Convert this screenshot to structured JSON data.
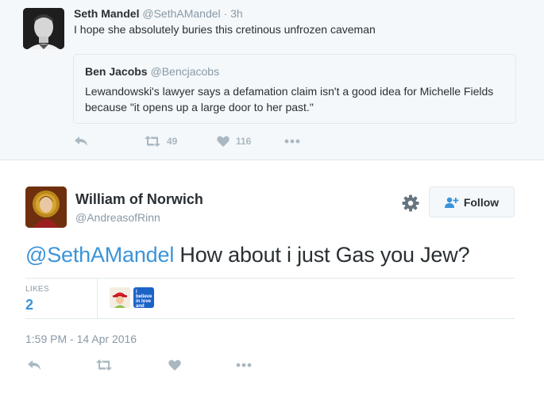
{
  "context_tweet": {
    "name": "Seth Mandel",
    "handle": "@SethAMandel",
    "separator": "·",
    "time": "3h",
    "text": "I hope she absolutely buries this cretinous unfrozen caveman",
    "quoted": {
      "name": "Ben Jacobs",
      "handle": "@Bencjacobs",
      "text": "Lewandowski's lawyer says a defamation claim isn't a good idea for Michelle Fields because \"it opens up a large door to her past.\""
    },
    "actions": {
      "reply_icon": "reply-icon",
      "retweet_icon": "retweet-icon",
      "retweet_count": "49",
      "like_icon": "heart-icon",
      "like_count": "116",
      "more_icon": "more-icon"
    }
  },
  "main_tweet": {
    "name": "William of Norwich",
    "handle": "@AndreasofRinn",
    "follow_label": "Follow",
    "mention": "@SethAMandel",
    "text": " How about i just Gas you Jew?",
    "likes_label": "LIKES",
    "likes_count": "2",
    "liker_badge_text": "i believe in love and kindness",
    "timestamp": "1:59 PM - 14 Apr 2016"
  },
  "colors": {
    "accent": "#3b94d9",
    "muted": "#8899a6",
    "icon": "#aab8c2",
    "background_context": "#f5f8fa"
  }
}
